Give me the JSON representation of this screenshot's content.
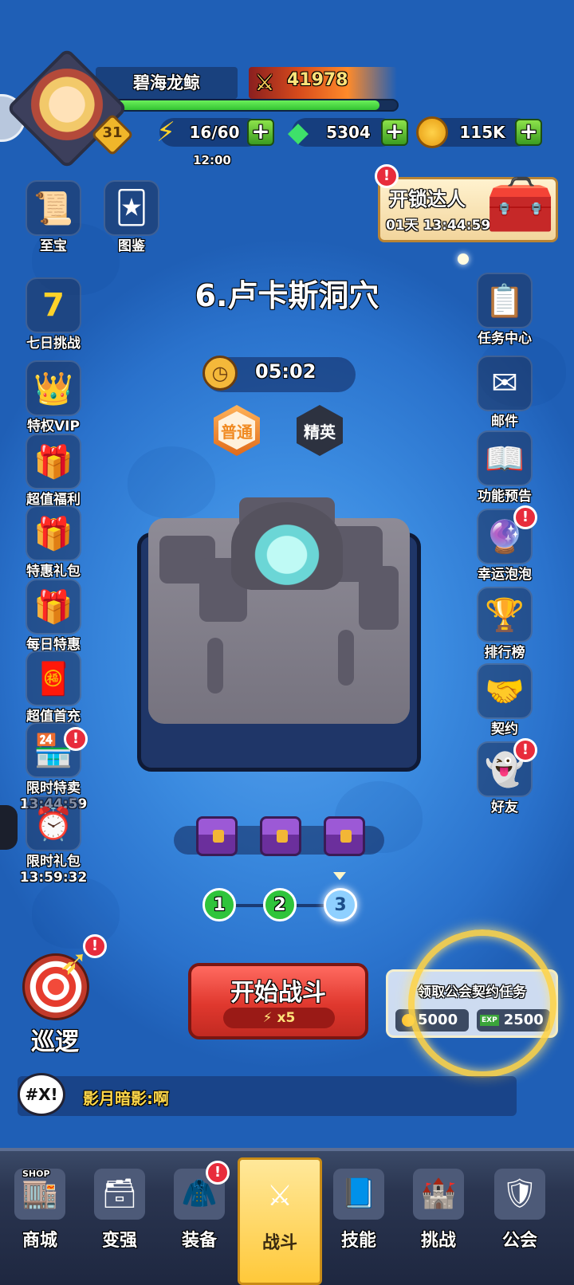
{
  "player": {
    "name": "碧海龙鲸",
    "level": "31",
    "power": "41978",
    "xp_fraction": 0.94
  },
  "resources": {
    "stamina": "16/60",
    "stamina_timer": "12:00",
    "gems": "5304",
    "coins": "115K",
    "plus": "+"
  },
  "event": {
    "title": "开锁达人",
    "time": "01天 13:44:59",
    "badge": "!"
  },
  "left_menu": [
    {
      "label": "至宝",
      "icon": "scroll-icon"
    },
    {
      "label": "图鉴",
      "icon": "card-collection-icon"
    },
    {
      "label": "七日挑战",
      "icon": "seven-gem-icon"
    },
    {
      "label": "特权VIP",
      "icon": "crown-icon"
    },
    {
      "label": "超值福利",
      "icon": "gift-chest-icon"
    },
    {
      "label": "特惠礼包",
      "icon": "gift-box-icon"
    },
    {
      "label": "每日特惠",
      "icon": "blue-gift-icon"
    },
    {
      "label": "超值首充",
      "icon": "red-envelope-icon"
    },
    {
      "label": "限时特卖",
      "timer": "13:44:59",
      "icon": "shop-stall-icon",
      "badge": "!"
    },
    {
      "label": "限时礼包",
      "timer": "13:59:32",
      "icon": "clock-gift-icon"
    }
  ],
  "right_menu": [
    {
      "label": "任务中心",
      "icon": "task-scroll-icon"
    },
    {
      "label": "邮件",
      "icon": "mail-icon"
    },
    {
      "label": "功能预告",
      "icon": "book-magnifier-icon"
    },
    {
      "label": "幸运泡泡",
      "icon": "bubble-icon",
      "badge": "!"
    },
    {
      "label": "排行榜",
      "icon": "podium-icon"
    },
    {
      "label": "契约",
      "icon": "handshake-icon"
    },
    {
      "label": "好友",
      "icon": "friends-icon",
      "badge": "!"
    }
  ],
  "stage": {
    "title": "6.卢卡斯洞穴",
    "timer": "05:02",
    "difficulty_normal": "普通",
    "difficulty_elite": "精英"
  },
  "progress": {
    "steps": [
      "1",
      "2",
      "3"
    ],
    "current_step": 3
  },
  "patrol": {
    "label": "巡逻",
    "badge": "!"
  },
  "start_button": {
    "label": "开始战斗",
    "cost": "x5"
  },
  "guild_task": {
    "title": "领取公会契约任务",
    "coin_reward": "5000",
    "exp_reward": "2500",
    "exp_tag": "EXP"
  },
  "chat": {
    "icon_text": "#X!",
    "message": "影月暗影:啊"
  },
  "bottom_nav": [
    {
      "label": "商城",
      "icon": "shop-icon",
      "tag": "SHOP"
    },
    {
      "label": "变强",
      "icon": "chest-upgrade-icon"
    },
    {
      "label": "装备",
      "icon": "equipment-icon",
      "badge": "!"
    },
    {
      "label": "战斗",
      "icon": "crossed-swords-icon",
      "active": true
    },
    {
      "label": "技能",
      "icon": "skill-book-icon"
    },
    {
      "label": "挑战",
      "icon": "gate-icon"
    },
    {
      "label": "公会",
      "icon": "guild-shield-icon"
    }
  ],
  "colors": {
    "background": "#2f7fd8",
    "start_button": "#e0382e",
    "plus_button": "#3b9c21",
    "xp_bar": "#33c232",
    "badge": "#e82c3c",
    "nav_active": "#ffc93a"
  }
}
